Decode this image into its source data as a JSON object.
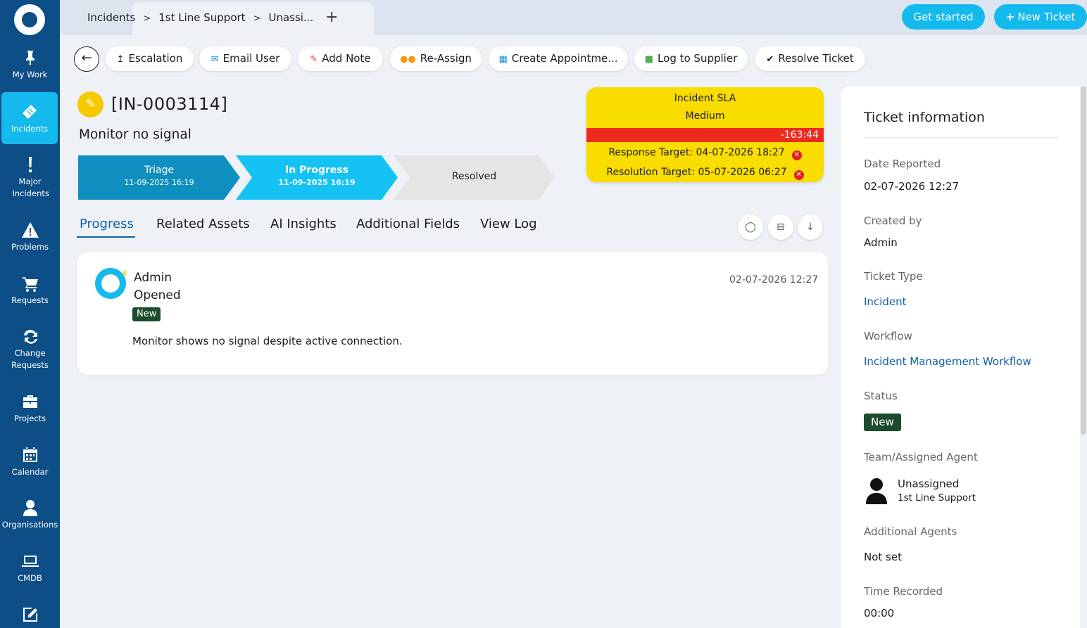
{
  "sidebar": {
    "items": [
      {
        "label": "My Work",
        "icon": "pin-icon"
      },
      {
        "label": "Incidents",
        "icon": "ticket-icon"
      },
      {
        "label": "Major Incidents",
        "icon": "exclamation-icon"
      },
      {
        "label": "Problems",
        "icon": "warning-icon"
      },
      {
        "label": "Requests",
        "icon": "cart-icon"
      },
      {
        "label": "Change Requests",
        "icon": "refresh-icon"
      },
      {
        "label": "Projects",
        "icon": "briefcase-icon"
      },
      {
        "label": "Calendar",
        "icon": "calendar-icon"
      },
      {
        "label": "Organisations",
        "icon": "user-icon"
      },
      {
        "label": "CMDB",
        "icon": "laptop-icon"
      }
    ]
  },
  "breadcrumb": [
    "Incidents",
    "1st Line Support",
    "Unassi..."
  ],
  "topbar": {
    "get_started": "Get started",
    "new_ticket": "New Ticket"
  },
  "toolbar": {
    "escalation": "Escalation",
    "email_user": "Email User",
    "add_note": "Add Note",
    "reassign": "Re-Assign",
    "create_appointment": "Create Appointme...",
    "log_to_supplier": "Log to Supplier",
    "resolve_ticket": "Resolve Ticket"
  },
  "ticket": {
    "id": "[IN-0003114]",
    "title": "Monitor no signal"
  },
  "stages": [
    {
      "name": "Triage",
      "date": "11-09-2025 16:19"
    },
    {
      "name": "In Progress",
      "date": "11-09-2025 16:19"
    },
    {
      "name": "Resolved",
      "date": ""
    }
  ],
  "sla": {
    "title": "Incident SLA",
    "priority": "Medium",
    "remaining": "-163:44",
    "response_target": "Response Target: 04-07-2026 18:27",
    "resolution_target": "Resolution Target: 05-07-2026 06:27"
  },
  "tabs": [
    "Progress",
    "Related Assets",
    "AI Insights",
    "Additional Fields",
    "View Log"
  ],
  "progress": {
    "user": "Admin",
    "action": "Opened",
    "badge": "New",
    "date": "02-07-2026 12:27",
    "text": "Monitor shows no signal despite active connection."
  },
  "info": {
    "title": "Ticket information",
    "date_reported_label": "Date Reported",
    "date_reported": "02-07-2026 12:27",
    "created_by_label": "Created by",
    "created_by": "Admin",
    "ticket_type_label": "Ticket Type",
    "ticket_type": "Incident",
    "workflow_label": "Workflow",
    "workflow": "Incident Management Workflow",
    "status_label": "Status",
    "status": "New",
    "team_label": "Team/Assigned Agent",
    "agent": "Unassigned",
    "team": "1st Line Support",
    "additional_agents_label": "Additional Agents",
    "additional_agents": "Not set",
    "time_recorded_label": "Time Recorded",
    "time_recorded": "00:00"
  },
  "colors": {
    "sidebar": "#0d4e86",
    "accent": "#14b9ee",
    "sla": "#f9dc00",
    "sla_breach": "#ee2a1f",
    "status_new": "#1c4c2c",
    "link": "#0e61a8"
  }
}
